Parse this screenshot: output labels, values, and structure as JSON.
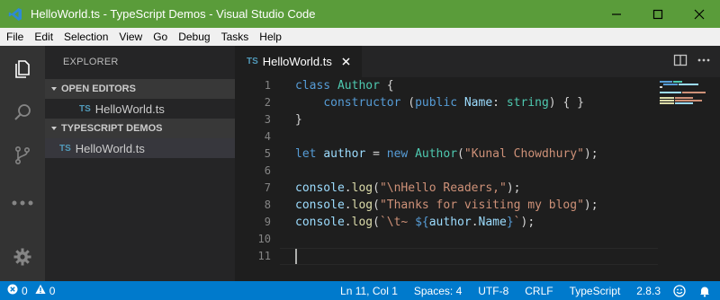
{
  "window": {
    "title": "HelloWorld.ts - TypeScript Demos - Visual Studio Code",
    "minimize_icon": "minimize-icon",
    "maximize_icon": "maximize-icon",
    "close_icon": "close-icon"
  },
  "menu": [
    "File",
    "Edit",
    "Selection",
    "View",
    "Go",
    "Debug",
    "Tasks",
    "Help"
  ],
  "activity_bar": [
    "files-icon",
    "search-icon",
    "source-control-icon",
    "more-icon",
    "settings-gear-icon"
  ],
  "sidebar": {
    "header": "EXPLORER",
    "open_editors_title": "OPEN EDITORS",
    "open_editors": [
      {
        "badge": "TS",
        "label": "HelloWorld.ts"
      }
    ],
    "project_title": "TYPESCRIPT DEMOS",
    "project_files": [
      {
        "badge": "TS",
        "label": "HelloWorld.ts"
      }
    ]
  },
  "tab": {
    "badge": "TS",
    "label": "HelloWorld.ts",
    "close": "×"
  },
  "editor": {
    "line_numbers": [
      "1",
      "2",
      "3",
      "4",
      "5",
      "6",
      "7",
      "8",
      "9",
      "10",
      "11"
    ],
    "lines": [
      [
        {
          "t": "class ",
          "c": "kw"
        },
        {
          "t": "Author",
          "c": "ty"
        },
        {
          "t": " {",
          "c": "pl"
        }
      ],
      [
        {
          "t": "    ",
          "c": "pl"
        },
        {
          "t": "constructor",
          "c": "kw"
        },
        {
          "t": " (",
          "c": "pl"
        },
        {
          "t": "public",
          "c": "kw"
        },
        {
          "t": " ",
          "c": "pl"
        },
        {
          "t": "Name",
          "c": "va"
        },
        {
          "t": ": ",
          "c": "pl"
        },
        {
          "t": "string",
          "c": "ty"
        },
        {
          "t": ") { }",
          "c": "pl"
        }
      ],
      [
        {
          "t": "}",
          "c": "pl"
        }
      ],
      [],
      [
        {
          "t": "let ",
          "c": "kw"
        },
        {
          "t": "author",
          "c": "va"
        },
        {
          "t": " = ",
          "c": "pl"
        },
        {
          "t": "new ",
          "c": "kw"
        },
        {
          "t": "Author",
          "c": "ty"
        },
        {
          "t": "(",
          "c": "pl"
        },
        {
          "t": "\"Kunal Chowdhury\"",
          "c": "st"
        },
        {
          "t": ");",
          "c": "pl"
        }
      ],
      [],
      [
        {
          "t": "console",
          "c": "va"
        },
        {
          "t": ".",
          "c": "pl"
        },
        {
          "t": "log",
          "c": "fn"
        },
        {
          "t": "(",
          "c": "pl"
        },
        {
          "t": "\"\\nHello Readers,\"",
          "c": "st"
        },
        {
          "t": ");",
          "c": "pl"
        }
      ],
      [
        {
          "t": "console",
          "c": "va"
        },
        {
          "t": ".",
          "c": "pl"
        },
        {
          "t": "log",
          "c": "fn"
        },
        {
          "t": "(",
          "c": "pl"
        },
        {
          "t": "\"Thanks for visiting my blog\"",
          "c": "st"
        },
        {
          "t": ");",
          "c": "pl"
        }
      ],
      [
        {
          "t": "console",
          "c": "va"
        },
        {
          "t": ".",
          "c": "pl"
        },
        {
          "t": "log",
          "c": "fn"
        },
        {
          "t": "(",
          "c": "pl"
        },
        {
          "t": "`\\t~ ",
          "c": "st"
        },
        {
          "t": "${",
          "c": "kw"
        },
        {
          "t": "author",
          "c": "va"
        },
        {
          "t": ".",
          "c": "pl"
        },
        {
          "t": "Name",
          "c": "va"
        },
        {
          "t": "}",
          "c": "kw"
        },
        {
          "t": "`",
          "c": "st"
        },
        {
          "t": ");",
          "c": "pl"
        }
      ],
      [],
      []
    ]
  },
  "status": {
    "errors": "0",
    "warnings": "0",
    "position": "Ln 11, Col 1",
    "indent": "Spaces: 4",
    "encoding": "UTF-8",
    "eol": "CRLF",
    "language": "TypeScript",
    "version": "2.8.3"
  },
  "colors": {
    "title_bar": "#5a9c3a",
    "status_bar": "#007acc",
    "editor_bg": "#1e1e1e",
    "sidebar_bg": "#252526",
    "activity_bar": "#333333"
  }
}
